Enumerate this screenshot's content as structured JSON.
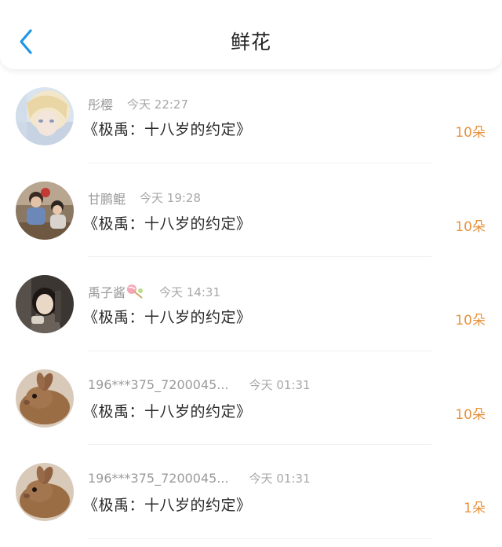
{
  "header": {
    "title": "鲜花"
  },
  "colors": {
    "accent": "#1e96e6",
    "count": "#e8923c",
    "name": "#9a9a9a"
  },
  "icons": {
    "back": "chevron-left-icon"
  },
  "items": [
    {
      "name": "彤樱",
      "time": "今天 22:27",
      "book": "《极禹：十八岁的约定》",
      "count": "10朵"
    },
    {
      "name": "甘鹏鲲",
      "time": "今天 19:28",
      "book": "《极禹：十八岁的约定》",
      "count": "10朵"
    },
    {
      "name": "禹子酱",
      "emoji": "lollipop",
      "time": "今天 14:31",
      "book": "《极禹：十八岁的约定》",
      "count": "10朵"
    },
    {
      "name": "196***375_7200045...",
      "time": "今天 01:31",
      "book": "《极禹：十八岁的约定》",
      "count": "10朵"
    },
    {
      "name": "196***375_7200045...",
      "time": "今天 01:31",
      "book": "《极禹：十八岁的约定》",
      "count": "1朵"
    }
  ]
}
